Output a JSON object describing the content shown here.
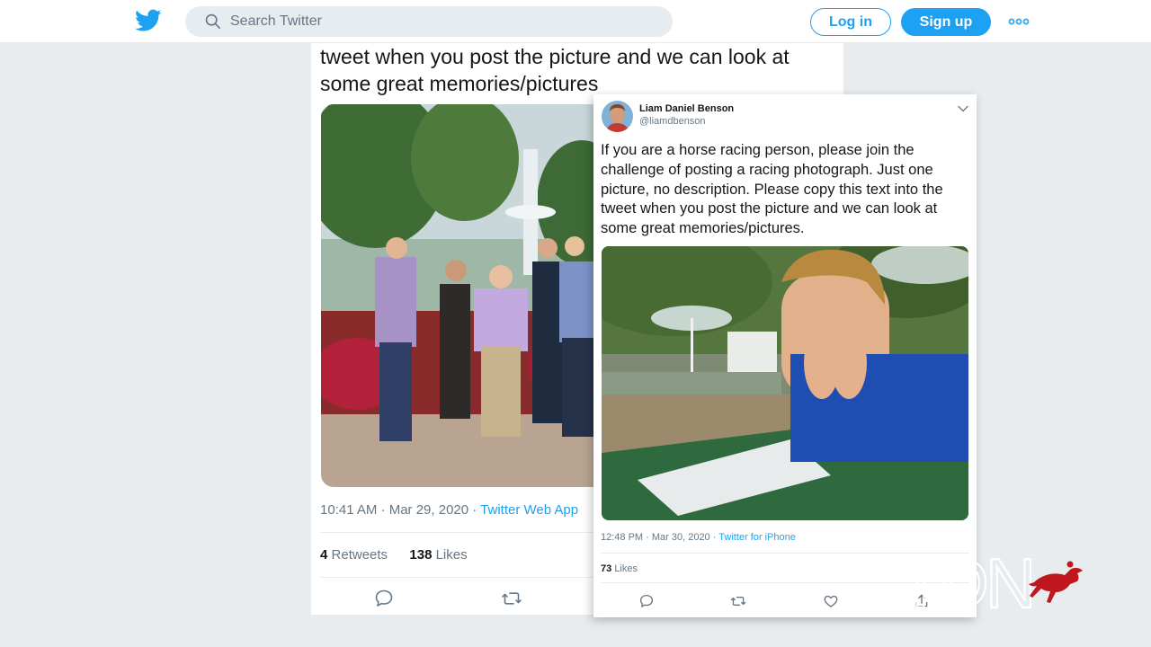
{
  "header": {
    "search_placeholder": "Search Twitter",
    "login_label": "Log in",
    "signup_label": "Sign up",
    "icons": [
      "twitter-bird-icon",
      "search-icon",
      "more-icon"
    ],
    "accent_color": "#1da1f2"
  },
  "back_tweet": {
    "text": "tweet when you post the picture and we can look at some great memories/pictures",
    "time": "10:41 AM · Mar 29, 2020",
    "separator": " · ",
    "source": "Twitter Web App",
    "retweets_count": "4",
    "retweets_label": "Retweets",
    "likes_count": "138",
    "likes_label": "Likes"
  },
  "front_tweet": {
    "author_name": "Liam Daniel Benson",
    "author_handle": "@liamdbenson",
    "text": "If you are a horse racing person, please join the challenge of posting a racing photograph. Just one picture, no description. Please copy this text into the tweet when you post the picture and we can look at some great memories/pictures.",
    "time": "12:48 PM · Mar 30, 2020",
    "separator": " · ",
    "source": "Twitter for iPhone",
    "likes_count": "73",
    "likes_label": "Likes"
  },
  "watermark": {
    "text": "TDN",
    "logo_color": "#c0161e"
  }
}
